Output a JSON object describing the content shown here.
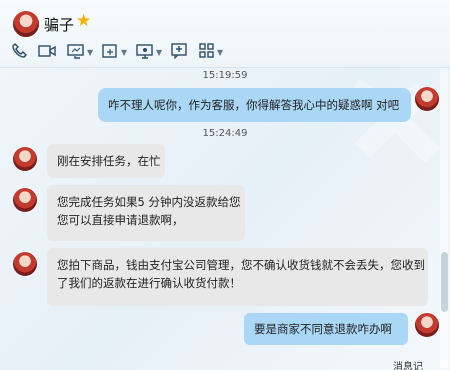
{
  "contact": {
    "name": "骗子"
  },
  "toolbar": {
    "icons": [
      "phone-icon",
      "video-icon",
      "screen-share-icon",
      "file-transfer-icon",
      "remote-desktop-icon",
      "add-icon",
      "apps-icon"
    ]
  },
  "messages": [
    {
      "type": "timestamp",
      "text": "15:19:59"
    },
    {
      "type": "self",
      "lines": [
        "咋不理人呢你，作为客服，你得解答我心中的疑惑啊 对吧"
      ]
    },
    {
      "type": "timestamp",
      "text": "15:24:49"
    },
    {
      "type": "other",
      "lines": [
        "刚在安排任务，在忙"
      ]
    },
    {
      "type": "other",
      "lines": [
        "您完成任务如果5 分钟内没返款给您",
        "您可以直接申请退款啊，"
      ]
    },
    {
      "type": "other",
      "lines": [
        "您拍下商品，钱由支付宝公司管理，您不确认收货钱就不会丢失，您收到",
        "了我们的返款在进行确认收货付款！"
      ]
    },
    {
      "type": "self",
      "lines": [
        "要是商家不同意退款咋办啊"
      ]
    }
  ],
  "footer": {
    "partial_label": "消息记"
  }
}
